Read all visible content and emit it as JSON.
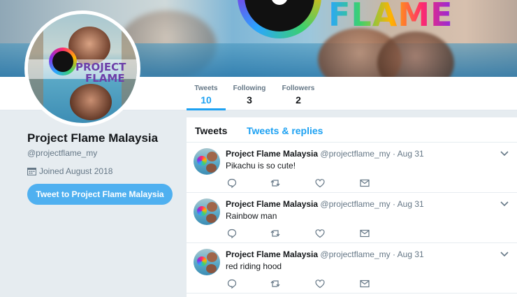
{
  "banner": {
    "brand_text": "FLAME"
  },
  "avatar": {
    "brand_lines": [
      "PROJECT",
      "FLAME"
    ]
  },
  "nav": {
    "stats": [
      {
        "label": "Tweets",
        "value": "10",
        "active": true
      },
      {
        "label": "Following",
        "value": "3"
      },
      {
        "label": "Followers",
        "value": "2"
      }
    ]
  },
  "profile": {
    "name": "Project Flame Malaysia",
    "handle": "@projectflame_my",
    "joined": "Joined August 2018",
    "tweet_button": "Tweet to Project Flame Malaysia"
  },
  "timeline": {
    "tabs": [
      "Tweets",
      "Tweets & replies"
    ],
    "tweets": [
      {
        "name": "Project Flame Malaysia",
        "handle": "@projectflame_my",
        "date": "· Aug 31",
        "text": "Pikachu is so cute!"
      },
      {
        "name": "Project Flame Malaysia",
        "handle": "@projectflame_my",
        "date": "· Aug 31",
        "text": "Rainbow man"
      },
      {
        "name": "Project Flame Malaysia",
        "handle": "@projectflame_my",
        "date": "· Aug 31",
        "text": "red riding hood"
      }
    ]
  },
  "colors": {
    "accent": "#1da1f2",
    "button": "#4fb0f0",
    "muted": "#657786",
    "background": "#e6ecf0"
  },
  "icons": [
    "calendar-icon",
    "reply-icon",
    "retweet-icon",
    "like-icon",
    "message-icon",
    "chevron-down-icon"
  ]
}
